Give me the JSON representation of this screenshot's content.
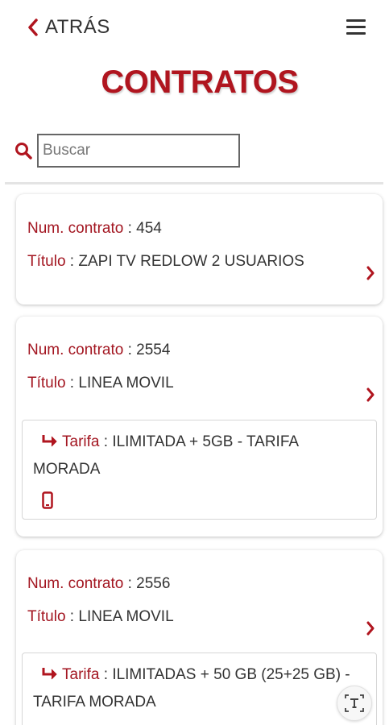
{
  "header": {
    "back_label": "ATRÁS",
    "menu_icon": "hamburger-icon",
    "title": "CONTRATOS"
  },
  "search": {
    "placeholder": "Buscar",
    "value": "",
    "icon": "search-icon"
  },
  "colors": {
    "accent": "#b0151f",
    "label": "#a31621",
    "text": "#333333"
  },
  "contracts": [
    {
      "num_label": "Num. contrato",
      "num_value": "454",
      "title_label": "Título",
      "title_value": "ZAPI TV REDLOW 2 USUARIOS"
    },
    {
      "num_label": "Num. contrato",
      "num_value": "2554",
      "title_label": "Título",
      "title_value": "LINEA MOVIL",
      "tarifa_label": "Tarifa",
      "tarifa_value": "ILIMITADA + 5GB - TARIFA MORADA"
    },
    {
      "num_label": "Num. contrato",
      "num_value": "2556",
      "title_label": "Título",
      "title_value": "LINEA MOVIL",
      "tarifa_label": "Tarifa",
      "tarifa_value": "ILIMITADAS + 50 GB (25+25 GB) - TARIFA MORADA"
    }
  ],
  "fab": {
    "icon": "text-resize-icon"
  }
}
